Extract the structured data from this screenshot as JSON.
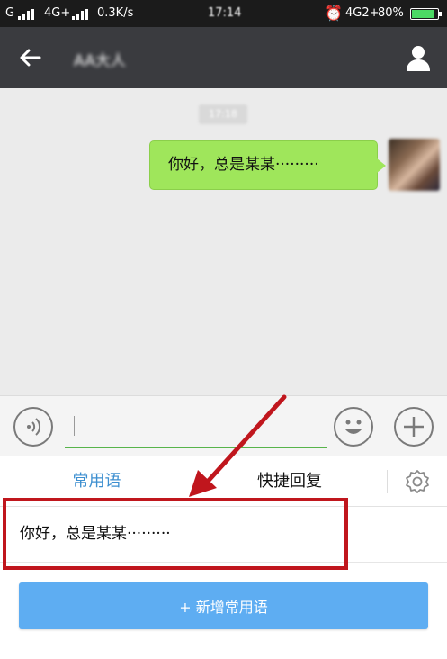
{
  "status_bar": {
    "carrier_1": "G",
    "carrier_2": "4G+",
    "speed": "0.3K/s",
    "time": "17:14",
    "network_right": "4G2+",
    "battery": "80%"
  },
  "nav": {
    "contact_name": "AA大人"
  },
  "chat": {
    "timestamp": "17:18",
    "message": "你好，总是某某·········"
  },
  "input": {
    "value": "",
    "placeholder": ""
  },
  "panel": {
    "tab_common_phrases": "常用语",
    "tab_quick_reply": "快捷回复",
    "phrases": [
      "你好，总是某某·········"
    ],
    "add_button_label": "+ 新增常用语"
  },
  "colors": {
    "accent_blue": "#5eadf2",
    "active_tab": "#3d8fd0",
    "bubble_green": "#9fe65b",
    "annotation_red": "#c0161d",
    "input_underline": "#57b44a"
  },
  "icons": {
    "back": "back-arrow-icon",
    "profile": "person-icon",
    "voice": "voice-icon",
    "emoji": "emoji-icon",
    "plus": "plus-icon",
    "settings": "gear-icon"
  }
}
